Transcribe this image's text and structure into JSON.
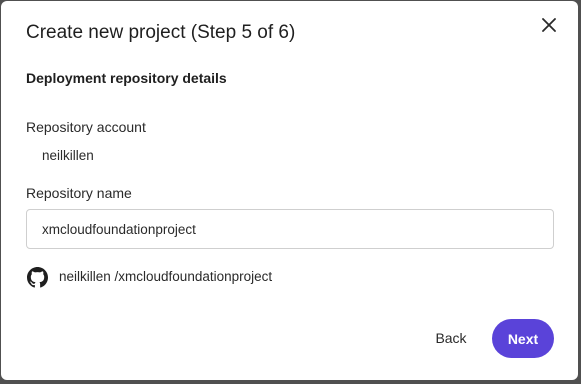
{
  "dialog": {
    "title": "Create new project (Step 5 of 6)",
    "section_heading": "Deployment repository details",
    "close_icon": "close-icon"
  },
  "repository_account": {
    "label": "Repository account",
    "value": "neilkillen"
  },
  "repository_name": {
    "label": "Repository name",
    "value": "xmcloudfoundationproject"
  },
  "repo_path": {
    "icon": "github-icon",
    "text": "neilkillen /xmcloudfoundationproject"
  },
  "footer": {
    "back_label": "Back",
    "next_label": "Next"
  },
  "colors": {
    "primary": "#5a43d9",
    "backdrop": "#505050",
    "text": "#1f1f1f"
  }
}
